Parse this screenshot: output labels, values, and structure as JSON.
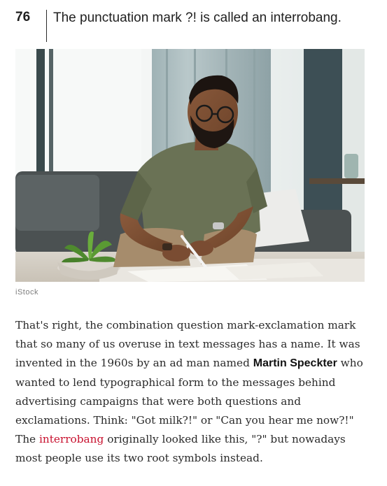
{
  "article": {
    "item_number": "76",
    "title": "The punctuation mark ?! is called an interrobang.",
    "image_credit": "iStock",
    "paragraph": {
      "part1": "That's right, the combination question mark-exclamation mark that so many of us overuse in text messages has a name. It was invented in the 1960s by an ad man named ",
      "name_link": "Martin Speckter",
      "part2": " who wanted to lend typographical form to the messages behind advertising campaigns that were both questions and exclamations. Think: \"Got milk?!\" or \"Can you hear me now?!\" The ",
      "term_link": "interrobang",
      "part3": " originally looked like this, \"?\" but nowadays most people use its two root symbols instead."
    }
  },
  "colors": {
    "link_red": "#c8102e",
    "text": "#2a2a2a",
    "credit_gray": "#7d7d7d"
  }
}
